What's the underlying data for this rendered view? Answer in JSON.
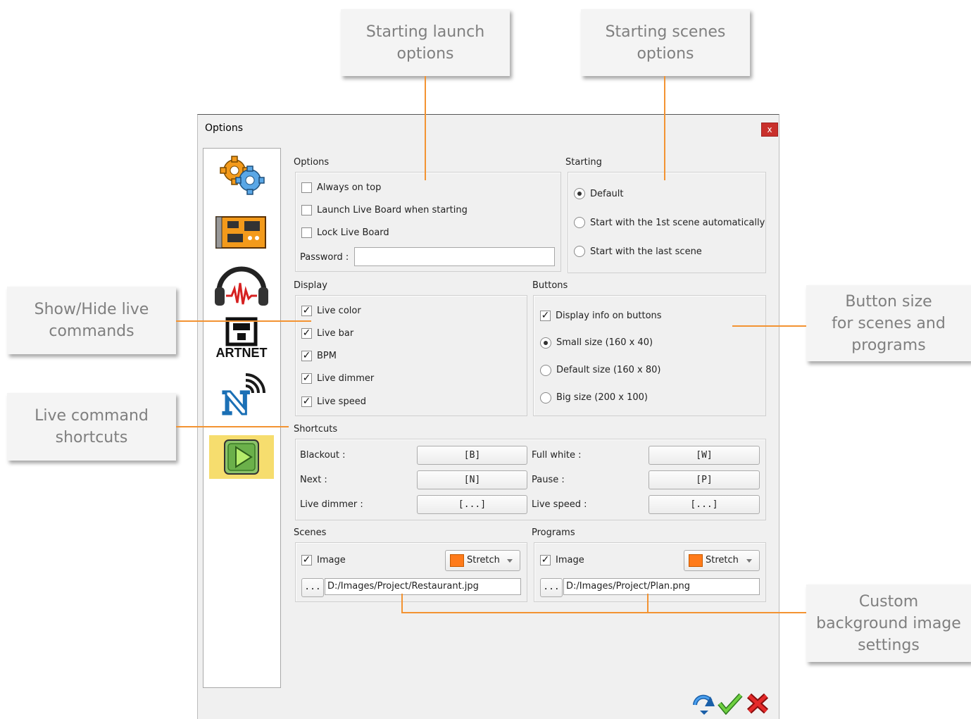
{
  "callouts": {
    "launch": "Starting launch\noptions",
    "scenes": "Starting scenes\noptions",
    "show_hide": "Show/Hide live\ncommands",
    "shortcuts": "Live command\nshortcuts",
    "button_size": "Button size\nfor scenes and\nprograms",
    "background": "Custom\nbackground image\nsettings"
  },
  "window": {
    "title": "Options",
    "close_label": "x"
  },
  "sidebar": {
    "items": [
      {
        "icon": "gears-icon"
      },
      {
        "icon": "dmx-interface-icon"
      },
      {
        "icon": "headphones-audio-icon"
      },
      {
        "icon": "artnet-icon",
        "label": "ARTNET"
      },
      {
        "icon": "network-wireless-icon"
      },
      {
        "icon": "live-play-icon"
      }
    ]
  },
  "options": {
    "title": "Options",
    "always_on_top": "Always on top",
    "launch_live_board": "Launch Live Board when starting",
    "lock_live_board": "Lock Live Board",
    "password_label": "Password :",
    "password_value": ""
  },
  "starting": {
    "title": "Starting",
    "default": "Default",
    "first_scene": "Start with the 1st scene automatically",
    "last_scene": "Start with the last scene"
  },
  "display": {
    "title": "Display",
    "live_color": "Live color",
    "live_bar": "Live bar",
    "bpm": "BPM",
    "live_dimmer": "Live dimmer",
    "live_speed": "Live speed",
    "check": "✓"
  },
  "buttons": {
    "title": "Buttons",
    "display_info": "Display info on buttons",
    "small": "Small size (160 x 40)",
    "default_size": "Default size (160 x 80)",
    "big": "Big size (200 x 100)"
  },
  "shortcuts": {
    "title": "Shortcuts",
    "blackout_label": "Blackout :",
    "blackout_key": "[B]",
    "full_white_label": "Full white :",
    "full_white_key": "[W]",
    "next_label": "Next :",
    "next_key": "[N]",
    "pause_label": "Pause :",
    "pause_key": "[P]",
    "live_dimmer_label": "Live dimmer :",
    "live_dimmer_key": "[...]",
    "live_speed_label": "Live speed :",
    "live_speed_key": "[...]"
  },
  "scenes": {
    "title": "Scenes",
    "image_label": "Image",
    "mode": "Stretch",
    "browse": "...",
    "path": "D:/Images/Project/Restaurant.jpg"
  },
  "programs": {
    "title": "Programs",
    "image_label": "Image",
    "mode": "Stretch",
    "browse": "...",
    "path": "D:/Images/Project/Plan.png"
  },
  "footer": {
    "reset_icon": "reset-arrow-icon",
    "ok_icon": "check-icon",
    "cancel_icon": "cancel-x-icon"
  },
  "colors": {
    "accent_line": "#f39332",
    "active_tab": "#f6dd6e",
    "close": "#c9302c",
    "swatch": "#ff7b1a"
  }
}
